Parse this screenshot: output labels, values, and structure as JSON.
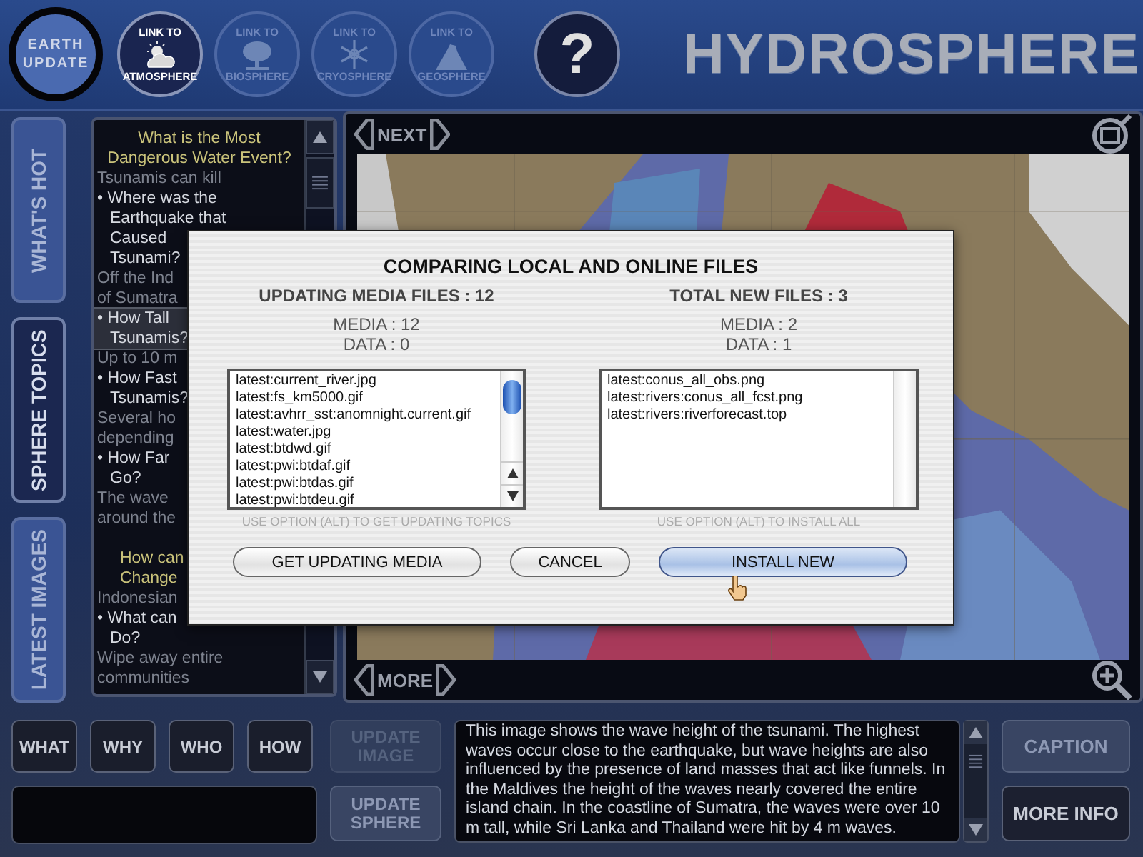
{
  "header": {
    "logo": {
      "lines": [
        "EARTH",
        "UPDATE"
      ]
    },
    "sphere_links": [
      {
        "top": "LINK TO",
        "name": "ATMOSPHERE",
        "kind": "cloud",
        "disabled": false
      },
      {
        "top": "LINK TO",
        "name": "BIOSPHERE",
        "kind": "tree",
        "disabled": true
      },
      {
        "top": "LINK TO",
        "name": "CRYOSPHERE",
        "kind": "snow",
        "disabled": true
      },
      {
        "top": "LINK TO",
        "name": "GEOSPHERE",
        "kind": "volcano",
        "disabled": true
      }
    ],
    "help": "?",
    "title": "HYDROSPHERE"
  },
  "side_tabs": [
    {
      "label": "WHAT'S HOT",
      "selected": false
    },
    {
      "label": "SPHERE TOPICS",
      "selected": true
    },
    {
      "label": "LATEST IMAGES",
      "selected": false
    }
  ],
  "topics": [
    {
      "kind": "heading",
      "lines": [
        "What is the Most",
        "Dangerous Water Event?"
      ]
    },
    {
      "kind": "answer",
      "lines": [
        "Tsunamis can kill"
      ]
    },
    {
      "kind": "question",
      "lines": [
        "• Where was the",
        "Earthquake that",
        "Caused",
        "Tsunami?"
      ],
      "selected": false
    },
    {
      "kind": "answer",
      "lines": [
        "Off the Ind",
        "of Sumatra"
      ]
    },
    {
      "kind": "question",
      "lines": [
        "• How Tall",
        "Tsunamis?"
      ],
      "selected": true
    },
    {
      "kind": "answer",
      "lines": [
        "Up to 10 m"
      ]
    },
    {
      "kind": "question",
      "lines": [
        "• How Fast",
        "Tsunamis?"
      ],
      "selected": false
    },
    {
      "kind": "answer",
      "lines": [
        "Several ho",
        "depending"
      ]
    },
    {
      "kind": "question",
      "lines": [
        "• How Far",
        "Go?"
      ],
      "selected": false
    },
    {
      "kind": "answer",
      "lines": [
        "The wave",
        "around the"
      ]
    },
    {
      "kind": "heading",
      "lines": [
        "How can",
        "Change"
      ]
    },
    {
      "kind": "answer",
      "lines": [
        "Indonesian"
      ]
    },
    {
      "kind": "question",
      "lines": [
        "• What can",
        "Do?"
      ],
      "selected": false
    },
    {
      "kind": "answer",
      "lines": [
        "Wipe away entire",
        "communities"
      ]
    }
  ],
  "viewer": {
    "next": "NEXT",
    "more": "MORE"
  },
  "question_buttons": [
    "WHAT",
    "WHY",
    "WHO",
    "HOW"
  ],
  "update_buttons": [
    {
      "label": "UPDATE IMAGE",
      "disabled": true
    },
    {
      "label": "UPDATE SPHERE",
      "disabled": false
    }
  ],
  "caption": {
    "text": "This image shows the wave height of the tsunami.  The highest waves occur close to the earthquake, but wave heights are also influenced by the presence of land masses that act like funnels.  In the Maldives the height of the waves nearly covered the entire island chain.  In the coastline of Sumatra, the waves were over 10 m tall, while Sri Lanka and Thailand were hit by 4 m waves."
  },
  "info_buttons": [
    {
      "label": "CAPTION",
      "selected": true
    },
    {
      "label": "MORE INFO",
      "selected": false
    }
  ],
  "dialog": {
    "title": "COMPARING LOCAL AND ONLINE FILES",
    "columns": [
      {
        "heading": "UPDATING MEDIA FILES : 12",
        "counts": [
          "MEDIA : 12",
          "DATA : 0"
        ],
        "files": [
          "latest:current_river.jpg",
          "latest:fs_km5000.gif",
          "latest:avhrr_sst:anomnight.current.gif",
          "latest:water.jpg",
          "latest:btdwd.gif",
          "latest:pwi:btdaf.gif",
          "latest:pwi:btdas.gif",
          "latest:pwi:btdeu.gif"
        ],
        "scrollable": true,
        "hint": "USE OPTION (ALT) TO GET UPDATING TOPICS"
      },
      {
        "heading": "TOTAL NEW FILES : 3",
        "counts": [
          "MEDIA : 2",
          "DATA : 1"
        ],
        "files": [
          "latest:conus_all_obs.png",
          "latest:rivers:conus_all_fcst.png",
          "latest:rivers:riverforecast.top"
        ],
        "scrollable": false,
        "hint": "USE OPTION (ALT) TO INSTALL ALL"
      }
    ],
    "buttons": [
      {
        "label": "GET UPDATING MEDIA",
        "default": false
      },
      {
        "label": "CANCEL",
        "default": false
      },
      {
        "label": "INSTALL NEW",
        "default": true
      }
    ]
  }
}
